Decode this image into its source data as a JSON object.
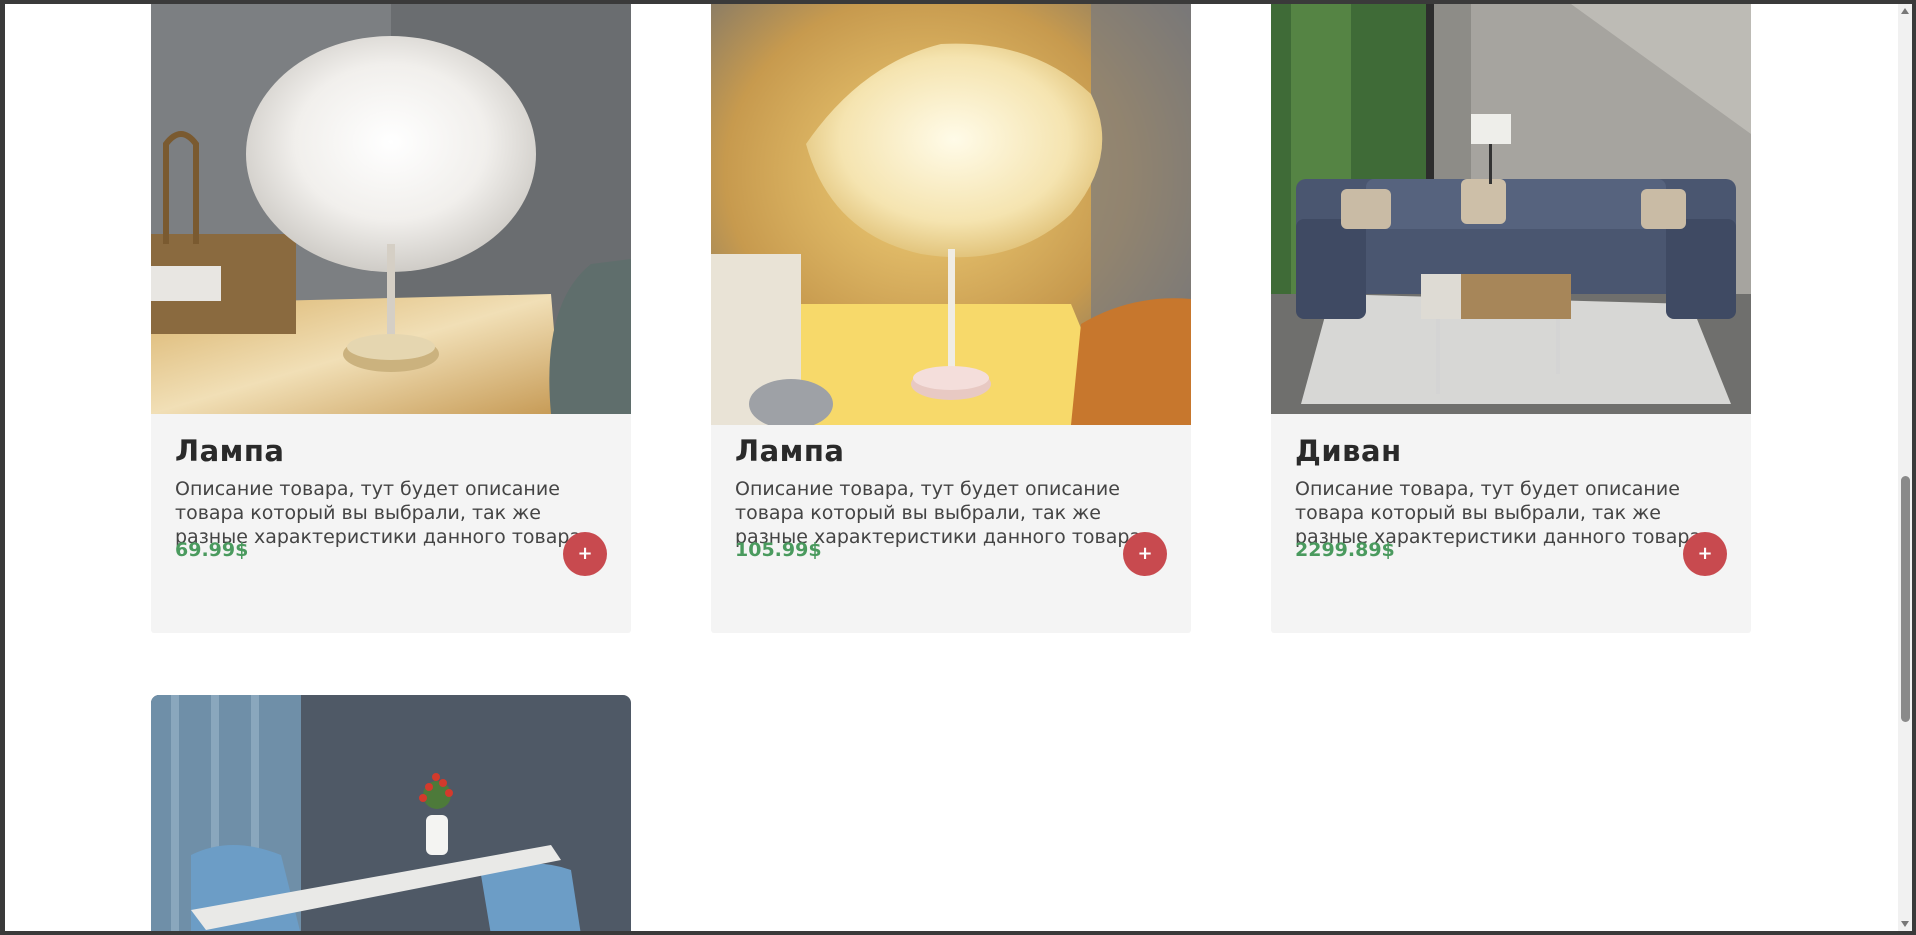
{
  "products": [
    {
      "title": "Лампа",
      "description": "Описание товара, тут будет описание товара который вы выбрали, так же разные характеристики данного товара",
      "price": "69.99$",
      "add_label": "+"
    },
    {
      "title": "Лампа",
      "description": "Описание товара, тут будет описание товара который вы выбрали, так же разные характеристики данного товара",
      "price": "105.99$",
      "add_label": "+"
    },
    {
      "title": "Диван",
      "description": "Описание товара, тут будет описание товара который вы выбрали, так же разные характеристики данного товара",
      "price": "2299.89$",
      "add_label": "+"
    }
  ],
  "colors": {
    "price": "#4a9a5e",
    "add_button": "#c84a4f",
    "card_bg": "#f4f4f4"
  },
  "icons": {
    "add": "plus-icon"
  }
}
